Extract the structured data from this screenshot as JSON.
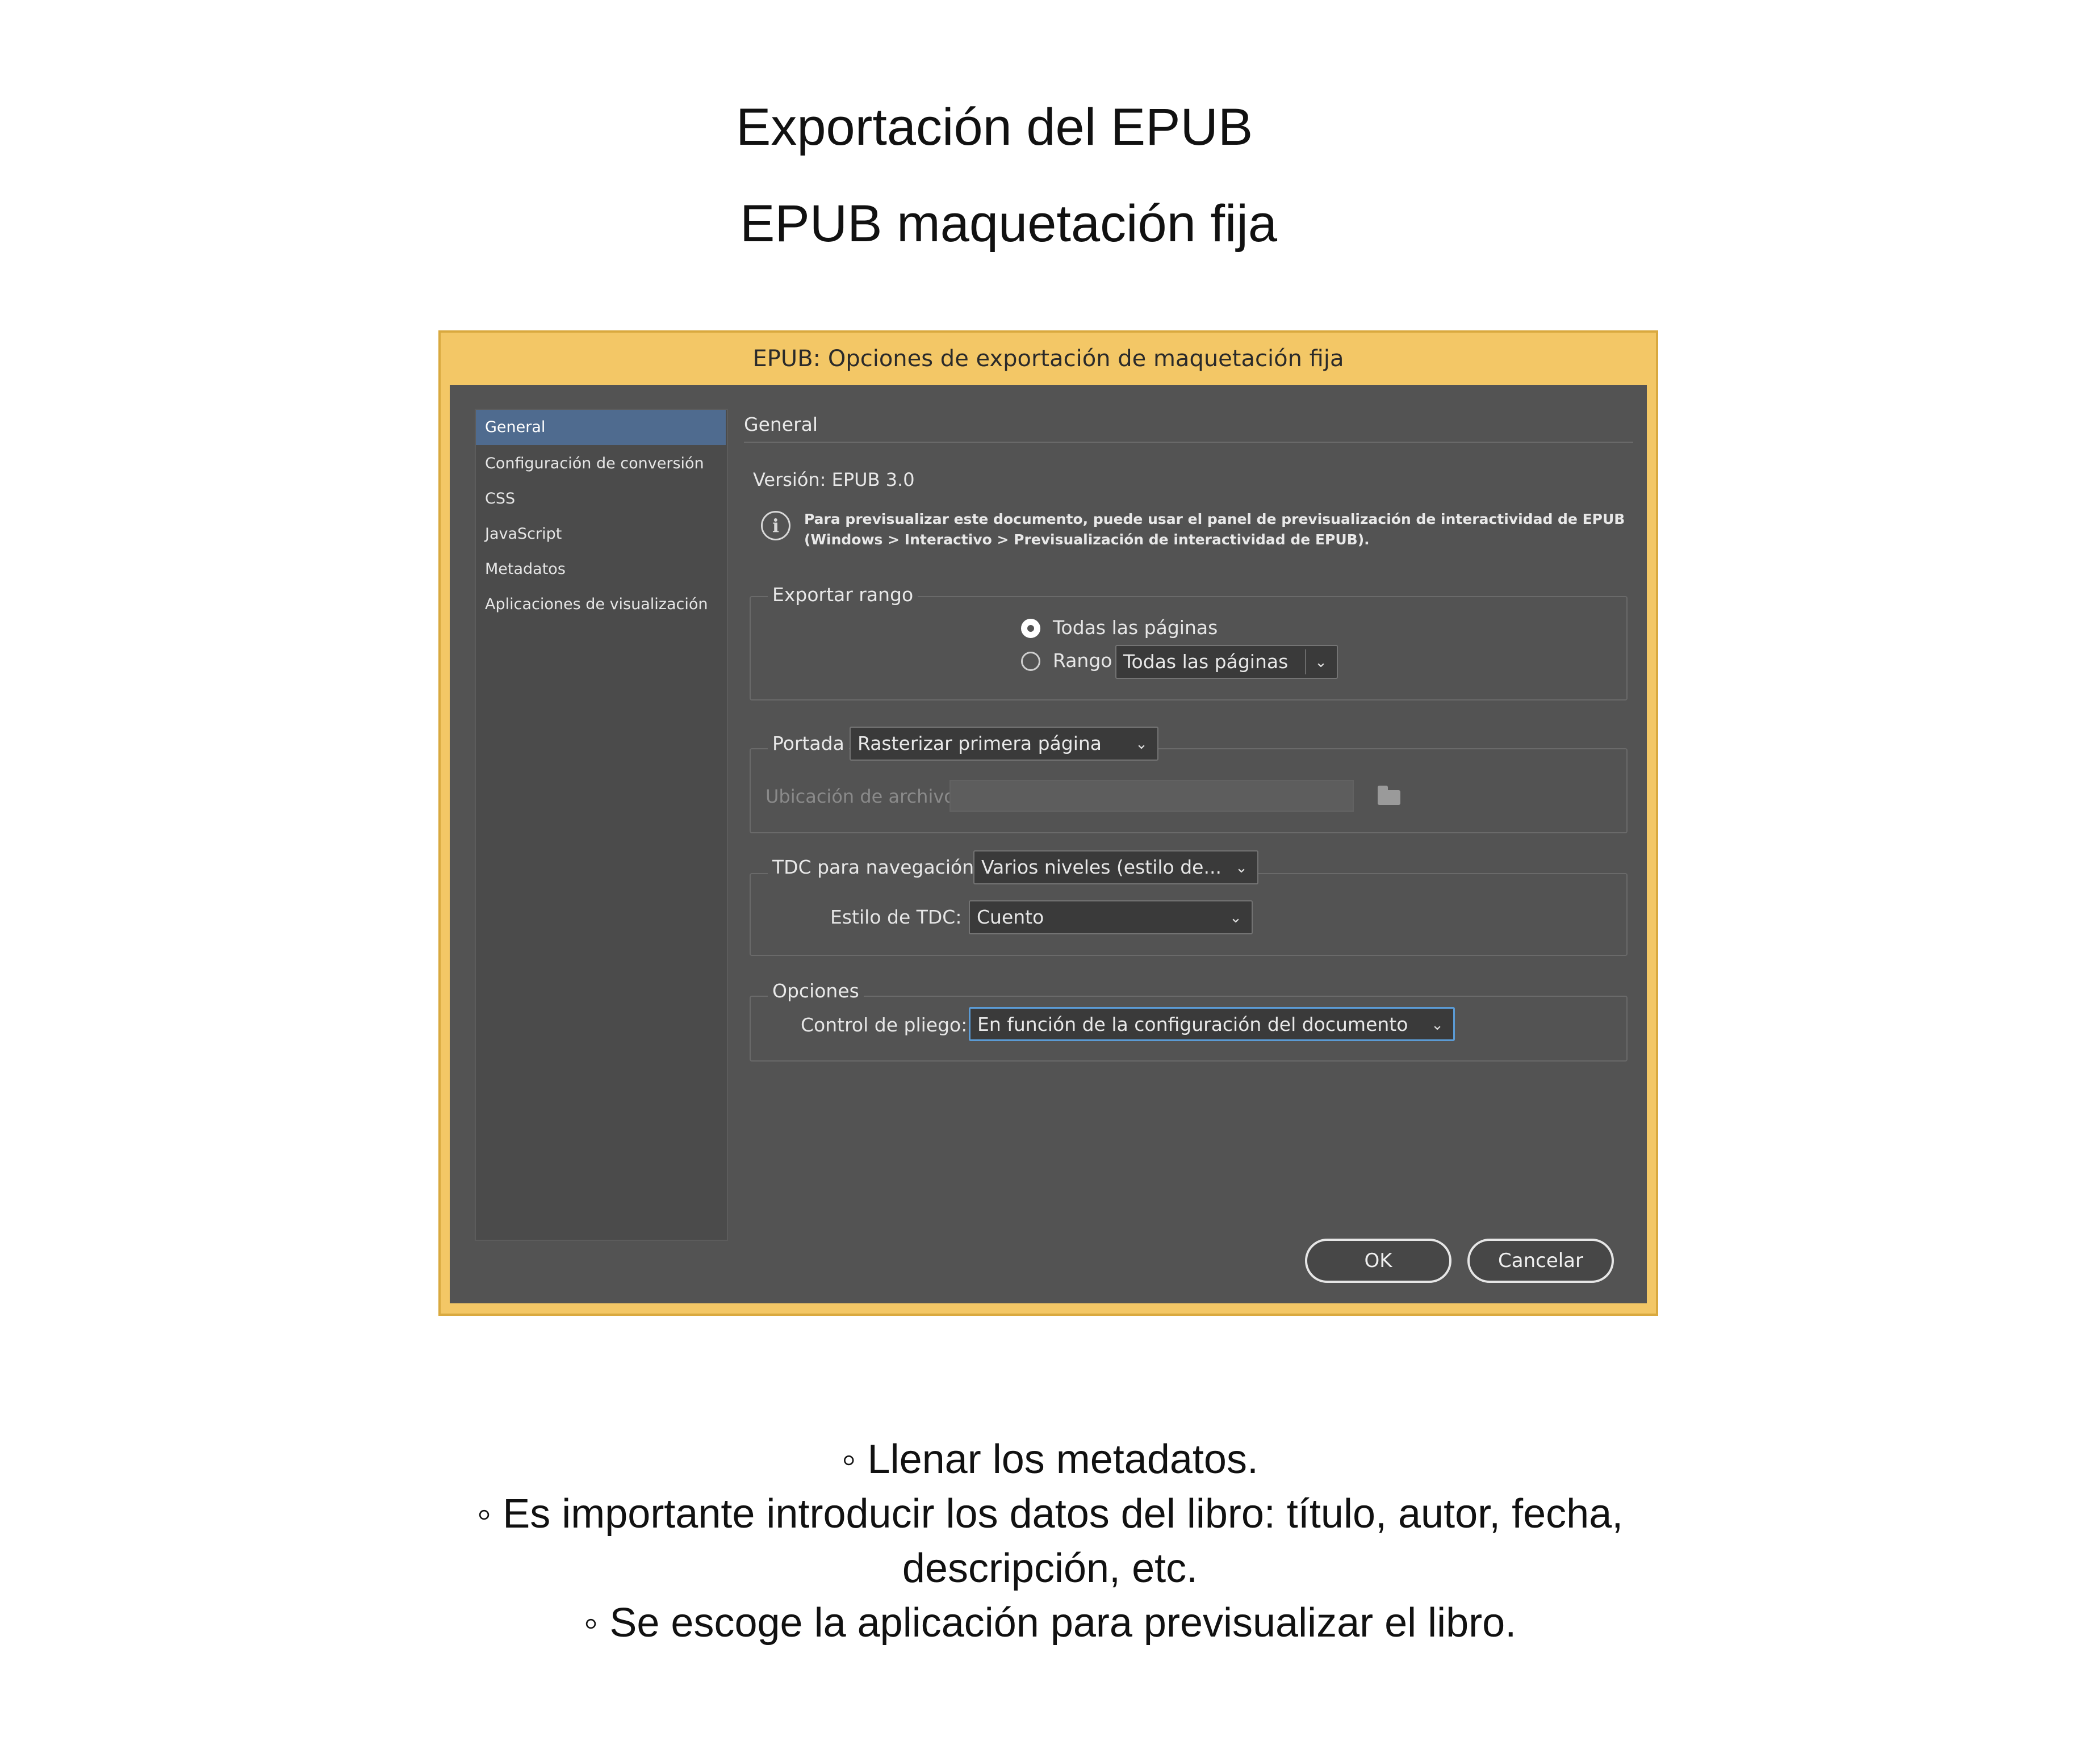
{
  "slide": {
    "title": "Exportación del EPUB",
    "subtitle": "EPUB maquetación fija"
  },
  "dialog": {
    "title": "EPUB: Opciones de exportación de maquetación fija",
    "sidebar": {
      "items": [
        {
          "label": "General",
          "selected": true
        },
        {
          "label": "Configuración de conversión",
          "selected": false
        },
        {
          "label": "CSS",
          "selected": false
        },
        {
          "label": "JavaScript",
          "selected": false
        },
        {
          "label": "Metadatos",
          "selected": false
        },
        {
          "label": "Aplicaciones de visualización",
          "selected": false
        }
      ]
    },
    "panel": {
      "heading": "General",
      "version": "Versión: EPUB 3.0",
      "info_line1": "Para previsualizar este documento, puede usar el panel de previsualización de interactividad de EPUB",
      "info_line2": "(Windows > Interactivo > Previsualización de interactividad de EPUB).",
      "export_range": {
        "group_label": "Exportar rango",
        "option_all": "Todas las páginas",
        "option_range": "Rango",
        "range_value": "Todas las páginas",
        "selected": "all"
      },
      "cover": {
        "label": "Portada",
        "value": "Rasterizar primera página",
        "file_location_label": "Ubicación de archivo:",
        "file_location_value": ""
      },
      "toc": {
        "nav_label": "TDC para navegación",
        "nav_value": "Varios niveles (estilo de...",
        "style_label": "Estilo de TDC:",
        "style_value": "Cuento"
      },
      "options": {
        "group_label": "Opciones",
        "spread_label": "Control de pliego:",
        "spread_value": "En función de la configuración del documento"
      }
    },
    "buttons": {
      "ok": "OK",
      "cancel": "Cancelar"
    }
  },
  "notes": [
    "◦ Llenar los metadatos.",
    "◦ Es importante introducir los datos del libro: título, autor, fecha,",
    "descripción, etc.",
    "◦ Se escoge la aplicación para previsualizar el libro."
  ],
  "colors": {
    "dialog_frame": "#f3c766",
    "dialog_body": "#535353",
    "selection": "#4f6b8f",
    "focus_ring": "#5b9bd5"
  }
}
